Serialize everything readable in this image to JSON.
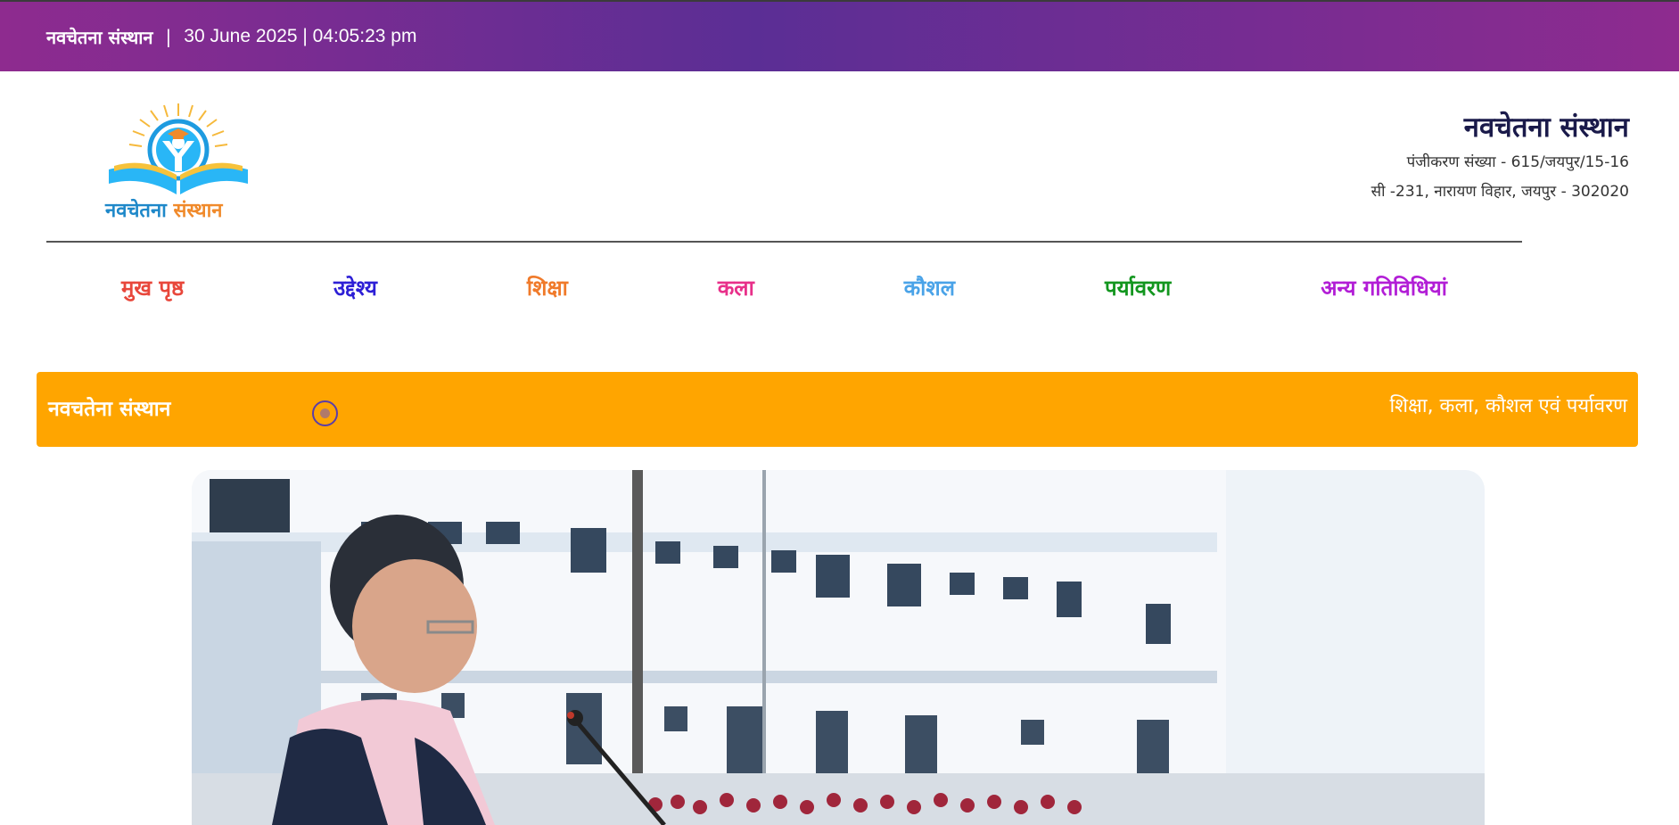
{
  "topbar": {
    "org_name": "नवचेतना संस्थान",
    "separator": "|",
    "datetime": "30 June 2025 | 04:05:23 pm"
  },
  "logo": {
    "text_part1": "नवचेतना",
    "text_part2": "संस्थान"
  },
  "header": {
    "org_name": "नवचेतना संस्थान",
    "registration": "पंजीकरण संख्या - 615/जयपुर/15-16",
    "address": "सी -231, नारायण विहार, जयपुर - 302020"
  },
  "nav": {
    "items": [
      {
        "label": "मुख पृष्ठ",
        "color": "#e8473b"
      },
      {
        "label": "उद्देश्य",
        "color": "#2d1fd6"
      },
      {
        "label": "शिक्षा",
        "color": "#f07a2a"
      },
      {
        "label": "कला",
        "color": "#e8308a"
      },
      {
        "label": "कौशल",
        "color": "#4aa3e8"
      },
      {
        "label": "पर्यावरण",
        "color": "#13961f"
      },
      {
        "label": "अन्य गतिविधियां",
        "color": "#b21ed6"
      }
    ]
  },
  "ticker": {
    "label": "नवचतेना संस्थान",
    "message": "शिक्षा, कला, कौशल एवं पर्यावरण"
  },
  "colors": {
    "topbar_gradient_start": "#8e2b8f",
    "topbar_gradient_mid": "#5b2e95",
    "ticker_bg": "#ffa500",
    "org_name": "#1a1a4a"
  }
}
